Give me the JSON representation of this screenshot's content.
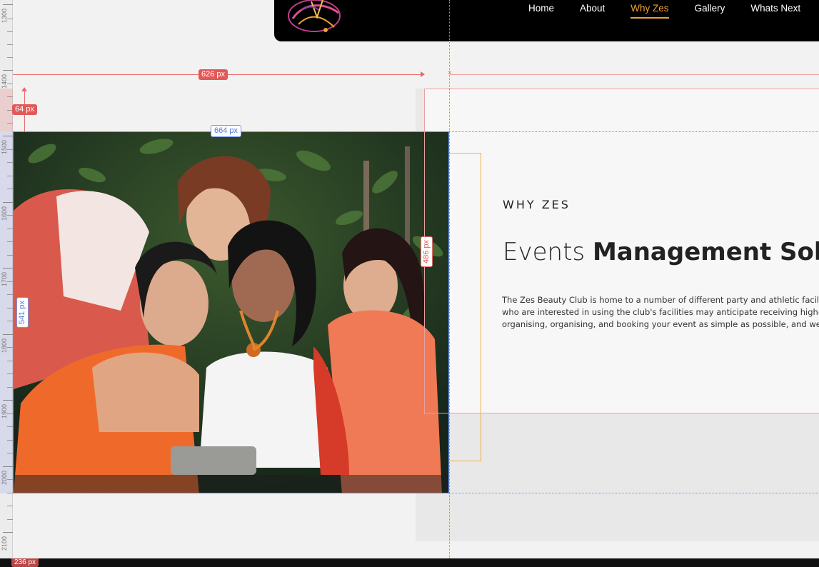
{
  "nav": {
    "items": [
      {
        "label": "Home",
        "active": false
      },
      {
        "label": "About",
        "active": false
      },
      {
        "label": "Why Zes",
        "active": true
      },
      {
        "label": "Gallery",
        "active": false
      },
      {
        "label": "Whats Next",
        "active": false
      }
    ],
    "active_color": "#f0a032"
  },
  "section": {
    "eyebrow": "WHY ZES",
    "heading_light": "Events ",
    "heading_bold": "Management Solu",
    "paragraph_lines": [
      "The Zes Beauty Club is home to a number of different party and athletic facilit",
      "who are interested in using the club's facilities may anticipate receiving high-c",
      "organising, organising, and booking your event as simple as possible, and we a"
    ]
  },
  "measurements": {
    "width_626": "626 px",
    "height_64": "64 px",
    "width_664": "664 px",
    "height_541": "541 px",
    "height_486": "486 px",
    "bottom_badge": "236 px"
  },
  "ruler": {
    "labels": [
      "1300",
      "1400",
      "1500",
      "1600",
      "1700",
      "1800",
      "1900",
      "2000",
      "2100"
    ]
  },
  "colors": {
    "guide_blue": "#6f95f0",
    "guide_red": "#e76a6a",
    "orange_outline": "#f2b045",
    "navbar_bg": "#000000"
  },
  "photo": {
    "description_icon": "group-photo-image"
  }
}
